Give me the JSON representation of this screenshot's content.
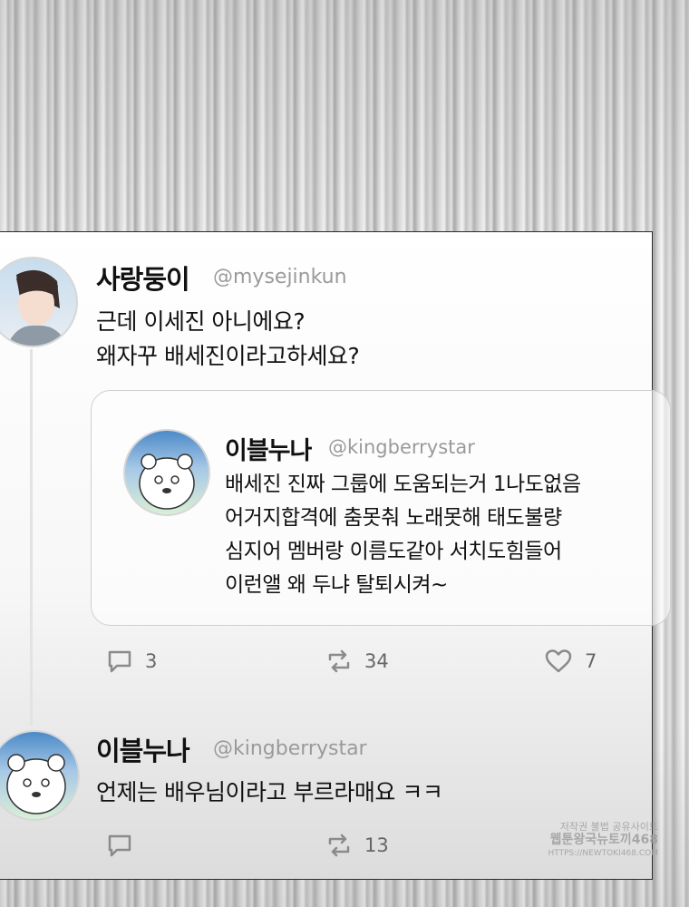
{
  "post": {
    "name": "사랑둥이",
    "handle": "@mysejinkun",
    "lines": [
      "근데 이세진 아니에요?",
      "왜자꾸 배세진이라고하세요?"
    ],
    "quote": {
      "name": "이블누나",
      "handle": "@kingberrystar",
      "lines": [
        "배세진 진짜 그룹에 도움되는거 1나도없음",
        "어거지합격에 춤못춰 노래못해 태도불량",
        "심지어 멤버랑 이름도같아 서치도힘들어",
        "이런앨 왜 두냐 탈퇴시켜~"
      ]
    },
    "replies_count": "3",
    "retweets_count": "34",
    "likes_count": "7"
  },
  "reply": {
    "name": "이블누나",
    "handle": "@kingberrystar",
    "text": "언제는 배우님이라고 부르라매요 ㅋㅋ",
    "retweets_count": "13"
  },
  "watermark": {
    "line1": "저작권 불법 공유사이트",
    "line2": "웹툰왕국뉴토끼468",
    "line3": "HTTPS://NEWTOKI468.COM"
  },
  "icons": {
    "reply": "speech-bubble-icon",
    "retweet": "retweet-icon",
    "like": "heart-icon"
  },
  "colors": {
    "icon_gray": "#8a8a8a",
    "handle_gray": "#9a9a9a"
  }
}
